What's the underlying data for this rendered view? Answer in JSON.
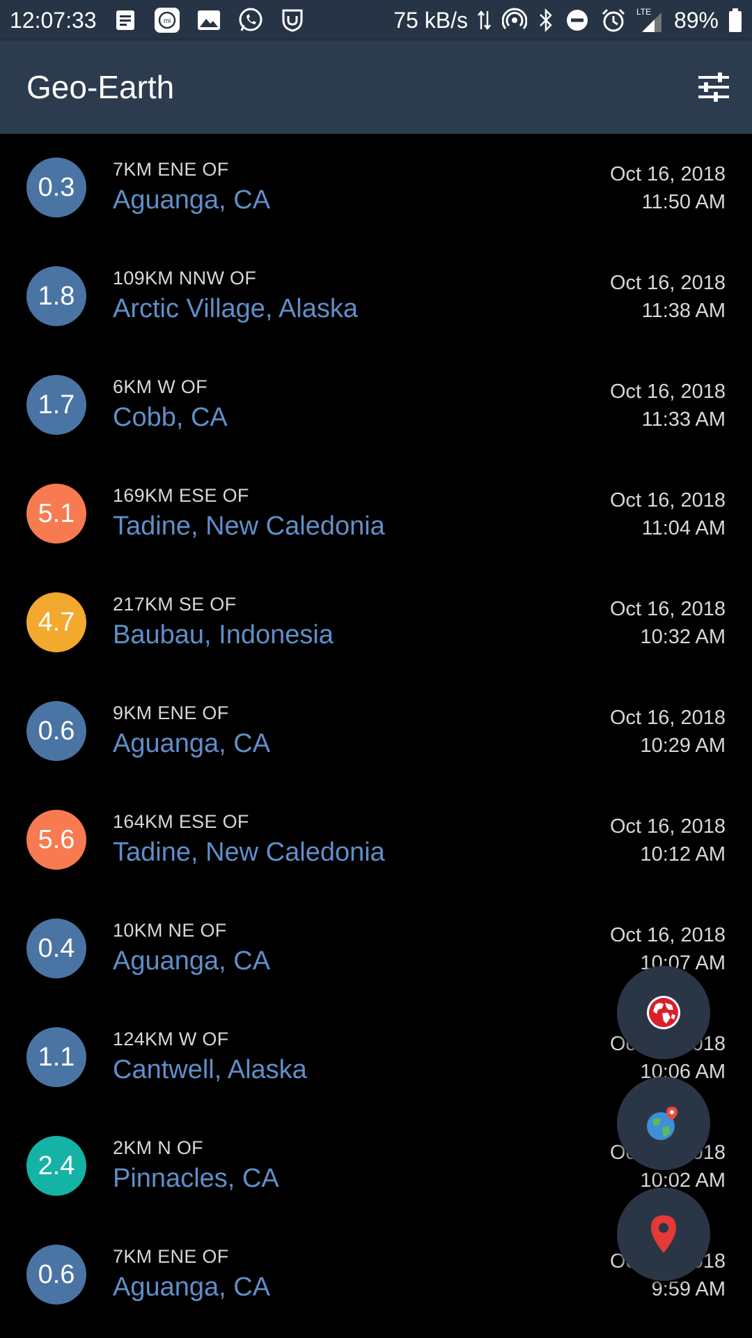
{
  "status_bar": {
    "time": "12:07:33",
    "speed": "75 kB/s",
    "network": "LTE",
    "battery": "89%",
    "left_icons": [
      "notes-icon",
      "mi-icon",
      "gallery-icon",
      "whatsapp-icon",
      "shield-app-icon"
    ],
    "right_icons": [
      "data-arrows-icon",
      "hotspot-icon",
      "bluetooth-icon",
      "dnd-icon",
      "alarm-icon",
      "signal-icon",
      "battery-icon"
    ]
  },
  "app_bar": {
    "title": "Geo-Earth",
    "filter_icon": "sliders-icon"
  },
  "colors": {
    "low": "#4a74a4",
    "orange": "#f87a50",
    "yellow": "#f3a92e",
    "teal": "#15b3a6",
    "link": "#5f8fc9",
    "background": "#000000",
    "appbar": "#2d3b4e"
  },
  "quakes": [
    {
      "mag": "0.3",
      "color": "#4a74a4",
      "distance": "7KM ENE OF",
      "place": "Aguanga, CA",
      "date": "Oct 16, 2018",
      "time": "11:50 AM"
    },
    {
      "mag": "1.8",
      "color": "#4a74a4",
      "distance": "109KM NNW OF",
      "place": "Arctic Village, Alaska",
      "date": "Oct 16, 2018",
      "time": "11:38 AM"
    },
    {
      "mag": "1.7",
      "color": "#4a74a4",
      "distance": "6KM W OF",
      "place": "Cobb, CA",
      "date": "Oct 16, 2018",
      "time": "11:33 AM"
    },
    {
      "mag": "5.1",
      "color": "#f87a50",
      "distance": "169KM ESE OF",
      "place": "Tadine, New Caledonia",
      "date": "Oct 16, 2018",
      "time": "11:04 AM"
    },
    {
      "mag": "4.7",
      "color": "#f3a92e",
      "distance": "217KM SE OF",
      "place": "Baubau, Indonesia",
      "date": "Oct 16, 2018",
      "time": "10:32 AM"
    },
    {
      "mag": "0.6",
      "color": "#4a74a4",
      "distance": "9KM ENE OF",
      "place": "Aguanga, CA",
      "date": "Oct 16, 2018",
      "time": "10:29 AM"
    },
    {
      "mag": "5.6",
      "color": "#f87a50",
      "distance": "164KM ESE OF",
      "place": "Tadine, New Caledonia",
      "date": "Oct 16, 2018",
      "time": "10:12 AM"
    },
    {
      "mag": "0.4",
      "color": "#4a74a4",
      "distance": "10KM NE OF",
      "place": "Aguanga, CA",
      "date": "Oct 16, 2018",
      "time": "10:07 AM"
    },
    {
      "mag": "1.1",
      "color": "#4a74a4",
      "distance": "124KM W OF",
      "place": "Cantwell, Alaska",
      "date": "Oct 16, 2018",
      "time": "10:06 AM"
    },
    {
      "mag": "2.4",
      "color": "#15b3a6",
      "distance": "2KM N OF",
      "place": "Pinnacles, CA",
      "date": "Oct 16, 2018",
      "time": "10:02 AM"
    },
    {
      "mag": "0.6",
      "color": "#4a74a4",
      "distance": "7KM ENE OF",
      "place": "Aguanga, CA",
      "date": "Oct 16, 2018",
      "time": "9:59 AM"
    }
  ],
  "fabs": [
    {
      "name": "world-map-fab",
      "icon": "world-map-icon"
    },
    {
      "name": "globe-location-fab",
      "icon": "globe-pin-icon"
    },
    {
      "name": "map-pin-fab",
      "icon": "map-pin-icon"
    }
  ]
}
